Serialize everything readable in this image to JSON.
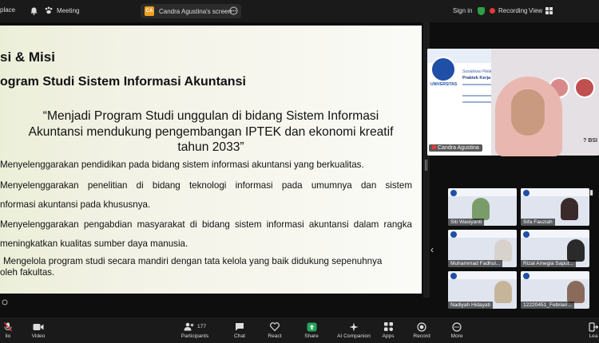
{
  "topbar": {
    "app_label": "place",
    "meeting_label": "Meeting",
    "screen_badge": "CA",
    "screen_label": "Candra Agustina's screen",
    "signin_label": "Sign in",
    "recording_label": "Recording",
    "view_label": "View"
  },
  "slide": {
    "title_line1": "si & Misi",
    "title_line2": "ogram Studi Sistem Informasi Akuntansi",
    "quote_line1": "“Menjadi Program Studi unggulan di bidang Sistem Informasi",
    "quote_line2": "Akuntansi mendukung pengembangan IPTEK dan ekonomi kreatif",
    "quote_line3": "tahun 2033”",
    "mission1": "Menyelenggarakan pendidikan pada bidang sistem informasi akuntansi yang berkualitas.",
    "mission2_a": "Menyelenggarakan penelitian di bidang teknologi informasi pada umumnya dan sistem",
    "mission2_b": "nformasi akuntansi pada khususnya.",
    "mission3_a": "Menyelenggarakan pengabdian masyarakat di bidang sistem informasi akuntansi dalam rangka",
    "mission3_b": "meningkatkan kualitas sumber daya manusia.",
    "mission4_a": "Mengelola program studi secara mandiri dengan tata kelola yang baik didukung sepenuhnya",
    "mission4_b": "oleh fakultas."
  },
  "speaker": {
    "name": "Candra Agustina",
    "flyer_title": "Praktek Kerja Lapangan (PKL)",
    "flyer_subtitle": "Sosialisasi Pelaksanaan",
    "flyer_univ": "UNIVERSITAS",
    "overflow_text": "? BSI"
  },
  "participants": [
    {
      "name": "Siti Wasiyanti"
    },
    {
      "name": "Sifa Fauziah"
    },
    {
      "name": "Muhammad Fadhul..."
    },
    {
      "name": "Rizal Amegia Saput..."
    },
    {
      "name": "Nadiyah Hidayati"
    },
    {
      "name": "12220451_Febrian..."
    }
  ],
  "toolbar": {
    "audio_label": "lio",
    "video_label": "Video",
    "participants_count": "177",
    "participants_label": "Participants",
    "chat_label": "Chat",
    "react_label": "React",
    "share_label": "Share",
    "ai_label": "AI Companion",
    "apps_label": "Apps",
    "record_label": "Record",
    "more_label": "More",
    "leave_label": "Lea"
  },
  "colors": {
    "share_green": "#23a55a",
    "record_red": "#e53935",
    "zoom_blue": "#1f4fa6"
  }
}
